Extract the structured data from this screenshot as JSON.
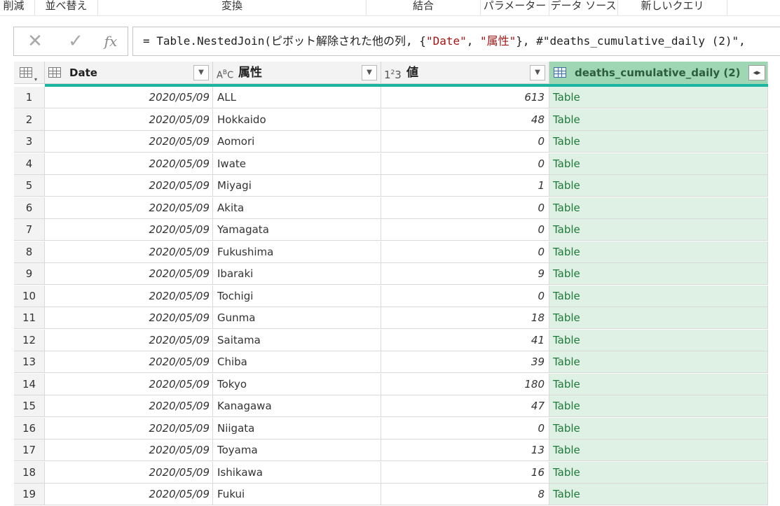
{
  "ribbon": {
    "groups": [
      "削減",
      "並べ替え",
      "変換",
      "結合",
      "パラメーター",
      "データ ソース",
      "新しいクエリ"
    ]
  },
  "formula_bar": {
    "cancel_icon": "close-icon",
    "commit_icon": "check-icon",
    "fx_label": "fx",
    "parts": {
      "p1": "= Table.NestedJoin(ピボット解除された他の列, {",
      "s1": "\"Date\"",
      "p2": ", ",
      "s2": "\"属性\"",
      "p3": "}, #\"deaths_cumulative_daily (2)\","
    }
  },
  "table": {
    "columns": [
      {
        "name": "Date",
        "type_icon": "table-icon"
      },
      {
        "name": "属性",
        "type_icon": "ABC"
      },
      {
        "name": "値",
        "type_icon": "123"
      },
      {
        "name": "deaths_cumulative_daily (2)",
        "type_icon": "table-icon"
      }
    ],
    "rows": [
      {
        "n": "1",
        "date": "2020/05/09",
        "attr": "ALL",
        "val": "613",
        "tbl": "Table"
      },
      {
        "n": "2",
        "date": "2020/05/09",
        "attr": "Hokkaido",
        "val": "48",
        "tbl": "Table"
      },
      {
        "n": "3",
        "date": "2020/05/09",
        "attr": "Aomori",
        "val": "0",
        "tbl": "Table"
      },
      {
        "n": "4",
        "date": "2020/05/09",
        "attr": "Iwate",
        "val": "0",
        "tbl": "Table"
      },
      {
        "n": "5",
        "date": "2020/05/09",
        "attr": "Miyagi",
        "val": "1",
        "tbl": "Table"
      },
      {
        "n": "6",
        "date": "2020/05/09",
        "attr": "Akita",
        "val": "0",
        "tbl": "Table"
      },
      {
        "n": "7",
        "date": "2020/05/09",
        "attr": "Yamagata",
        "val": "0",
        "tbl": "Table"
      },
      {
        "n": "8",
        "date": "2020/05/09",
        "attr": "Fukushima",
        "val": "0",
        "tbl": "Table"
      },
      {
        "n": "9",
        "date": "2020/05/09",
        "attr": "Ibaraki",
        "val": "9",
        "tbl": "Table"
      },
      {
        "n": "10",
        "date": "2020/05/09",
        "attr": "Tochigi",
        "val": "0",
        "tbl": "Table"
      },
      {
        "n": "11",
        "date": "2020/05/09",
        "attr": "Gunma",
        "val": "18",
        "tbl": "Table"
      },
      {
        "n": "12",
        "date": "2020/05/09",
        "attr": "Saitama",
        "val": "41",
        "tbl": "Table"
      },
      {
        "n": "13",
        "date": "2020/05/09",
        "attr": "Chiba",
        "val": "39",
        "tbl": "Table"
      },
      {
        "n": "14",
        "date": "2020/05/09",
        "attr": "Tokyo",
        "val": "180",
        "tbl": "Table"
      },
      {
        "n": "15",
        "date": "2020/05/09",
        "attr": "Kanagawa",
        "val": "47",
        "tbl": "Table"
      },
      {
        "n": "16",
        "date": "2020/05/09",
        "attr": "Niigata",
        "val": "0",
        "tbl": "Table"
      },
      {
        "n": "17",
        "date": "2020/05/09",
        "attr": "Toyama",
        "val": "13",
        "tbl": "Table"
      },
      {
        "n": "18",
        "date": "2020/05/09",
        "attr": "Ishikawa",
        "val": "16",
        "tbl": "Table"
      },
      {
        "n": "19",
        "date": "2020/05/09",
        "attr": "Fukui",
        "val": "8",
        "tbl": "Table"
      }
    ]
  },
  "colors": {
    "selected_column_header": "#9fd7b4",
    "selected_column_cells": "#dff0e5",
    "table_link_text": "#1e7a38",
    "quality_bar": "#1ab5a0",
    "formula_string": "#a31515"
  }
}
